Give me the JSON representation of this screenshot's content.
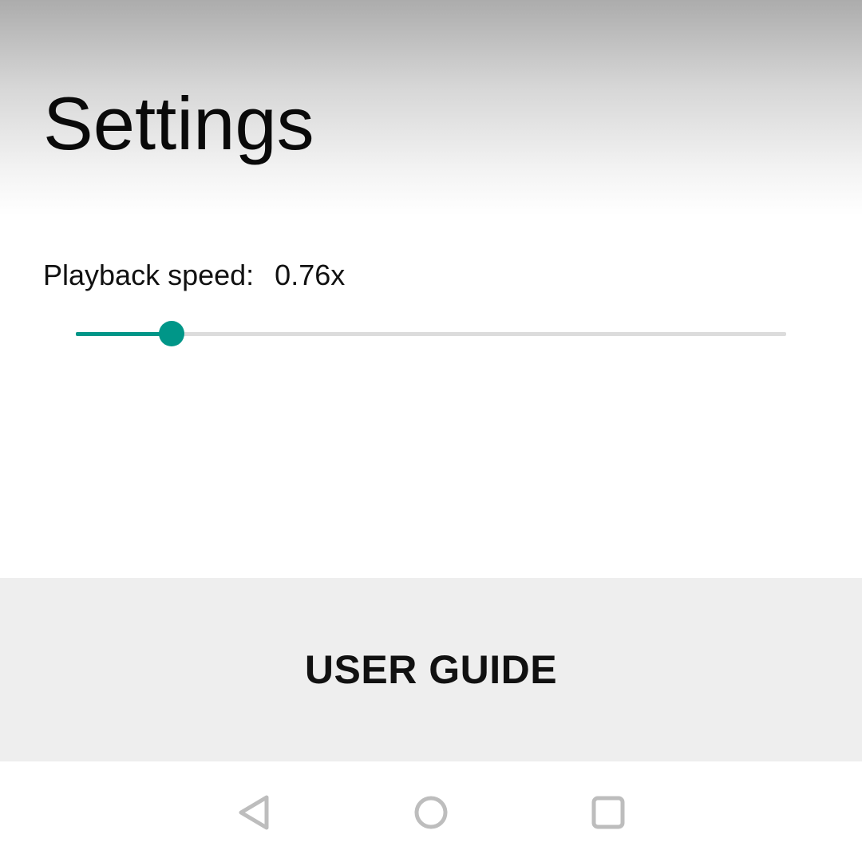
{
  "header": {
    "title": "Settings"
  },
  "playback": {
    "label": "Playback speed:",
    "value_text": "0.76x",
    "slider": {
      "fraction": 0.135,
      "accent_color": "#009688",
      "track_color": "#dcdcdc"
    }
  },
  "user_guide": {
    "label": "USER GUIDE",
    "background": "#eeeeee"
  },
  "navbar": {
    "icons": [
      "back-icon",
      "home-icon",
      "recents-icon"
    ],
    "icon_color": "#bdbdbd"
  }
}
